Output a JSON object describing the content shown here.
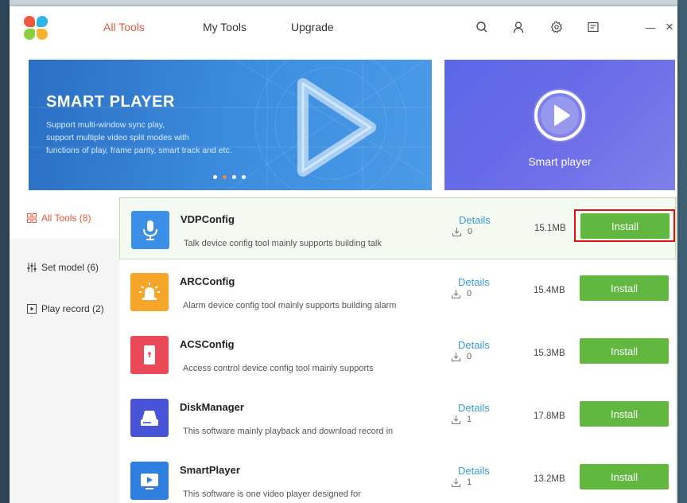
{
  "nav": {
    "tabs": [
      {
        "label": "All Tools",
        "active": true
      },
      {
        "label": "My Tools",
        "active": false
      },
      {
        "label": "Upgrade",
        "active": false
      }
    ],
    "icons": [
      "search-icon",
      "user-icon",
      "settings-icon",
      "notes-icon",
      "minimize-icon",
      "close-icon"
    ],
    "minimize_glyph": "—",
    "close_glyph": "×"
  },
  "banner": {
    "title": "SMART PLAYER",
    "lines": [
      "Support multi-window sync play,",
      "support multiple video split modes with",
      "functions of play, frame parity, smart track and etc."
    ],
    "active_slide": 2,
    "slide_count": 4
  },
  "side_banner": {
    "label": "Smart player"
  },
  "sidebar": {
    "items": [
      {
        "label": "All Tools (8)",
        "icon": "grid-icon",
        "active": true
      },
      {
        "label": "Set model (6)",
        "icon": "sliders-icon",
        "active": false
      },
      {
        "label": "Play record (2)",
        "icon": "play-record-icon",
        "active": false
      }
    ]
  },
  "apps": [
    {
      "name": "VDPConfig",
      "desc": "Talk device config tool mainly supports building talk",
      "details": "Details",
      "downloads": "0",
      "size": "15.1MB",
      "install": "Install",
      "icon_color": "#3b8fe6",
      "icon": "microphone-icon",
      "selected": true
    },
    {
      "name": "ARCConfig",
      "desc": "Alarm device config tool mainly supports building alarm",
      "details": "Details",
      "downloads": "0",
      "size": "15.4MB",
      "install": "Install",
      "icon_color": "#f5a52a",
      "icon": "alarm-icon",
      "selected": false
    },
    {
      "name": "ACSConfig",
      "desc": "Access control device config tool mainly supports",
      "details": "Details",
      "downloads": "0",
      "size": "15.3MB",
      "install": "Install",
      "icon_color": "#ea4a55",
      "icon": "door-icon",
      "selected": false
    },
    {
      "name": "DiskManager",
      "desc": "This software mainly playback and download record in",
      "details": "Details",
      "downloads": "1",
      "size": "17.8MB",
      "install": "Install",
      "icon_color": "#4853d8",
      "icon": "disk-icon",
      "selected": false
    },
    {
      "name": "SmartPlayer",
      "desc": "This software is one video player designed for",
      "details": "Details",
      "downloads": "1",
      "size": "13.2MB",
      "install": "Install",
      "icon_color": "#2f7fe0",
      "icon": "player-icon",
      "selected": false
    }
  ]
}
